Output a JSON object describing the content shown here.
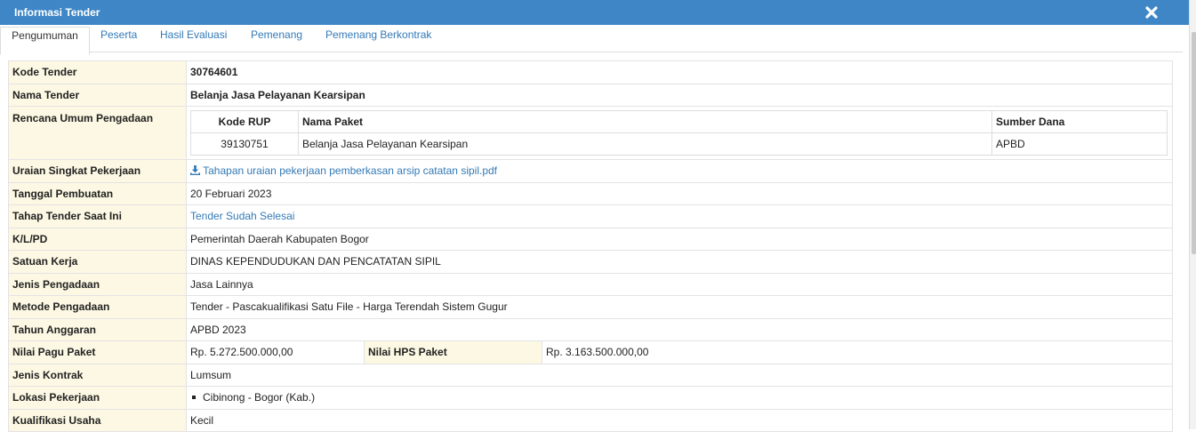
{
  "window": {
    "title": "Informasi Tender",
    "close_icon": "close-icon"
  },
  "tabs": [
    {
      "label": "Pengumuman",
      "active": true
    },
    {
      "label": "Peserta"
    },
    {
      "label": "Hasil Evaluasi"
    },
    {
      "label": "Pemenang"
    },
    {
      "label": "Pemenang Berkontrak"
    }
  ],
  "info": {
    "kode_tender": {
      "label": "Kode Tender",
      "value": "30764601"
    },
    "nama_tender": {
      "label": "Nama Tender",
      "value": "Belanja Jasa Pelayanan Kearsipan"
    },
    "rup": {
      "label": "Rencana Umum Pengadaan",
      "headers": [
        "Kode RUP",
        "Nama Paket",
        "Sumber Dana"
      ],
      "rows": [
        [
          "39130751",
          "Belanja Jasa Pelayanan Kearsipan",
          "APBD"
        ]
      ]
    },
    "uraian": {
      "label": "Uraian Singkat Pekerjaan",
      "value": "Tahapan uraian pekerjaan pemberkasan arsip catatan sipil.pdf",
      "icon": "download-icon"
    },
    "tanggal": {
      "label": "Tanggal Pembuatan",
      "value": "20 Februari 2023"
    },
    "tahap": {
      "label": "Tahap Tender Saat Ini",
      "value": "Tender Sudah Selesai"
    },
    "klpd": {
      "label": "K/L/PD",
      "value": "Pemerintah Daerah Kabupaten Bogor"
    },
    "satker": {
      "label": "Satuan Kerja",
      "value": "DINAS KEPENDUDUKAN DAN PENCATATAN SIPIL"
    },
    "jenis_pengadaan": {
      "label": "Jenis Pengadaan",
      "value": "Jasa Lainnya"
    },
    "metode": {
      "label": "Metode Pengadaan",
      "value": "Tender - Pascakualifikasi Satu File - Harga Terendah Sistem Gugur"
    },
    "tahun": {
      "label": "Tahun Anggaran",
      "value": "APBD 2023"
    },
    "pagu": {
      "label": "Nilai Pagu Paket",
      "value": "Rp. 5.272.500.000,00"
    },
    "hps": {
      "label": "Nilai HPS Paket",
      "value": "Rp. 3.163.500.000,00"
    },
    "kontrak": {
      "label": "Jenis Kontrak",
      "value": "Lumsum"
    },
    "lokasi": {
      "label": "Lokasi Pekerjaan",
      "value": "Cibinong - Bogor (Kab.)"
    },
    "kualifikasi": {
      "label": "Kualifikasi Usaha",
      "value": "Kecil"
    }
  }
}
